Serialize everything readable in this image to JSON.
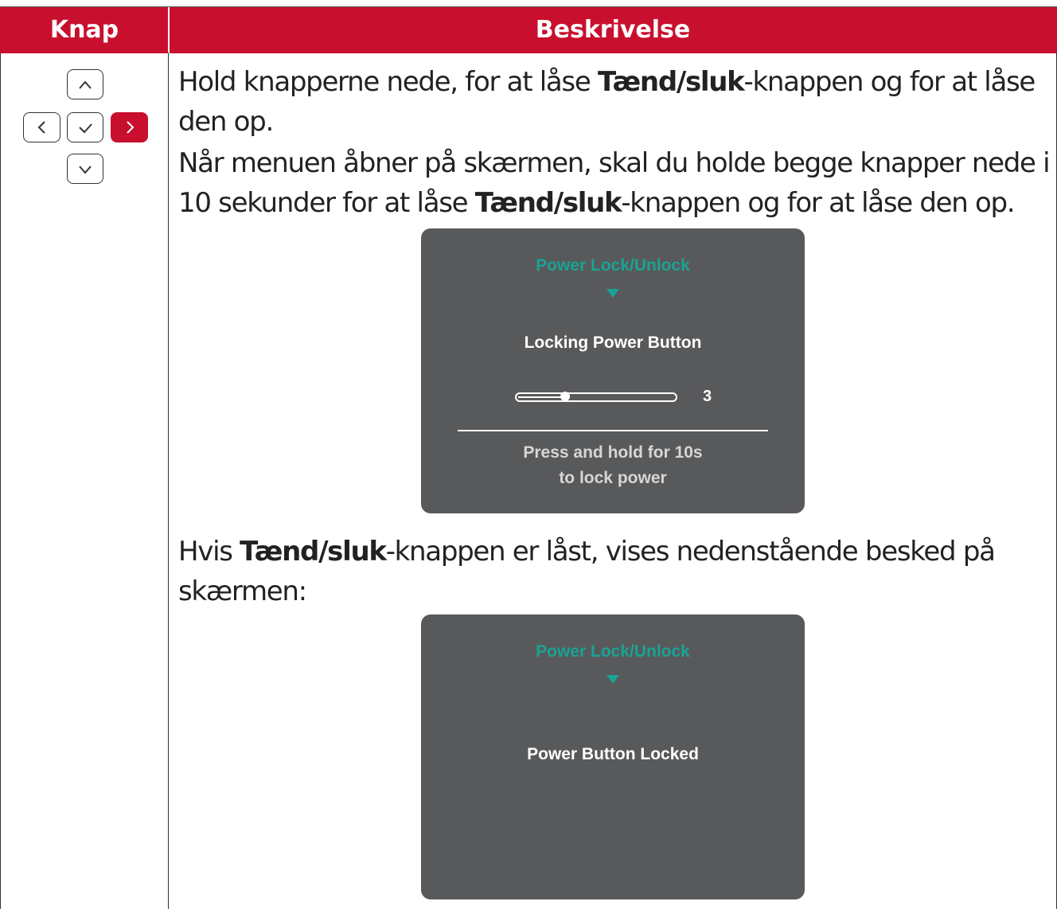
{
  "header": {
    "col_button": "Knap",
    "col_description": "Beskrivelse"
  },
  "dpad": {
    "up_icon": "chevron-up-icon",
    "left_icon": "chevron-left-icon",
    "ok_icon": "check-icon",
    "right_icon": "chevron-right-icon",
    "down_icon": "chevron-down-icon",
    "active_button": "right",
    "accent_color": "#c8102e"
  },
  "description": {
    "p1_before": "Hold knapperne nede, for at låse ",
    "p1_bold": "Tænd/sluk",
    "p1_after": "-knappen og for at låse den op.",
    "p2_before": "Når menuen åbner på skærmen, skal du holde begge knapper nede i 10 sekunder for at låse ",
    "p2_bold": "Tænd/sluk",
    "p2_after": "-knappen og for at låse den op.",
    "p3_before": "Hvis ",
    "p3_bold": "Tænd/sluk",
    "p3_after": "-knappen er låst, vises nedenstående besked på skærmen:"
  },
  "osd1": {
    "title": "Power Lock/Unlock",
    "message": "Locking Power Button",
    "countdown": "3",
    "slider_fraction": 0.3,
    "hint_line1": "Press and hold for 10s",
    "hint_line2": "to lock power",
    "title_color": "#1aa394",
    "background_color": "#58595b"
  },
  "osd2": {
    "title": "Power Lock/Unlock",
    "message": "Power Button Locked",
    "title_color": "#1aa394",
    "background_color": "#58595b"
  }
}
